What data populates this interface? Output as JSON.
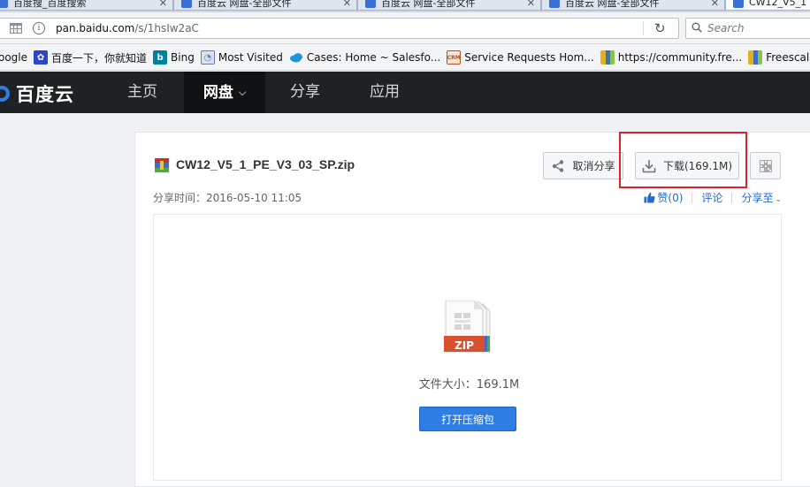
{
  "browser": {
    "tabs": [
      {
        "label": "百度搜_百度搜索",
        "color": "#3b6fd6"
      },
      {
        "label": "百度云 网盘-全部文件",
        "color": "#3b6fd6"
      },
      {
        "label": "百度云 网盘-全部文件",
        "color": "#3b6fd6"
      },
      {
        "label": "百度云 网盘-全部文件",
        "color": "#3b6fd6"
      },
      {
        "label": "CW12_V5_1",
        "color": "#3b6fd6"
      }
    ],
    "url_host": "pan.baidu.com",
    "url_path": "/s/1hsIw2aC",
    "search_placeholder": "Search",
    "bookmarks": [
      {
        "label": "oogle",
        "icon": "google-icon",
        "color": "#ffffff"
      },
      {
        "label": "百度一下，你就知道",
        "icon": "baidu-paw-icon",
        "color": "#2b46c9"
      },
      {
        "label": "Bing",
        "icon": "bing-icon",
        "color": "#00809d"
      },
      {
        "label": "Most Visited",
        "icon": "most-visited-icon",
        "color": "#6a7fa8"
      },
      {
        "label": "Cases: Home ~ Salesfo...",
        "icon": "salesforce-cloud-icon",
        "color": "#1b96d6"
      },
      {
        "label": "Service Requests Hom...",
        "icon": "crm-icon",
        "color": "#b3541e"
      },
      {
        "label": "https://community.fre...",
        "icon": "freescale-icon",
        "color": "#e2b21d"
      },
      {
        "label": "Freescale Semiconduc",
        "icon": "freescale-icon",
        "color": "#e2b21d"
      }
    ]
  },
  "baidu": {
    "logo_text": "百度云",
    "nav": [
      {
        "label": "主页",
        "active": false
      },
      {
        "label": "网盘",
        "active": true
      },
      {
        "label": "分享",
        "active": false
      },
      {
        "label": "应用",
        "active": false
      }
    ]
  },
  "file": {
    "name": "CW12_V5_1_PE_V3_03_SP.zip",
    "share_time": "分享时间：2016-05-10 11:05",
    "cancel_share_label": "取消分享",
    "download_label": "下载(169.1M)",
    "like_label": "赞(0)",
    "comment_label": "评论",
    "share_to_label": "分享至",
    "zip_badge": "ZIP",
    "size_text": "文件大小：169.1M",
    "open_zip_label": "打开压缩包"
  },
  "colors": {
    "accent": "#2d7de2",
    "highlight": "#e0212b",
    "header_bg": "#1f2225"
  }
}
